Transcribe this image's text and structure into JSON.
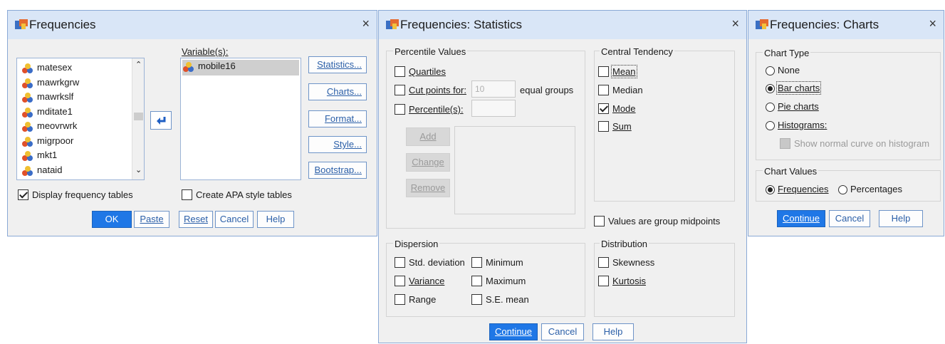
{
  "frequencies": {
    "title": "Frequencies",
    "close": "×",
    "variables_label": "Variable(s):",
    "source_items": [
      "matesex",
      "mawrkgrw",
      "mawrkslf",
      "mditate1",
      "meovrwrk",
      "migrpoor",
      "mkt1",
      "nataid"
    ],
    "target_items": [
      "mobile16"
    ],
    "side_buttons": [
      "Statistics...",
      "Charts...",
      "Format...",
      "Style...",
      "Bootstrap..."
    ],
    "display_freq": "Display frequency tables",
    "create_apa": "Create APA style tables",
    "buttons": {
      "ok": "OK",
      "paste": "Paste",
      "reset": "Reset",
      "cancel": "Cancel",
      "help": "Help"
    }
  },
  "statistics": {
    "title": "Frequencies: Statistics",
    "close": "×",
    "percentile_group": "Percentile Values",
    "quartiles": "Quartiles",
    "cut_points": "Cut points for:",
    "cut_value": "10",
    "equal_groups": "equal groups",
    "percentiles": "Percentile(s):",
    "add": "Add",
    "change": "Change",
    "remove": "Remove",
    "central_group": "Central Tendency",
    "mean": "Mean",
    "median": "Median",
    "mode": "Mode",
    "sum": "Sum",
    "group_midpoints": "Values are group midpoints",
    "dispersion_group": "Dispersion",
    "std_dev": "Std. deviation",
    "minimum": "Minimum",
    "variance": "Variance",
    "maximum": "Maximum",
    "range": "Range",
    "se_mean": "S.E. mean",
    "distribution_group": "Distribution",
    "skewness": "Skewness",
    "kurtosis": "Kurtosis",
    "buttons": {
      "continue": "Continue",
      "cancel": "Cancel",
      "help": "Help"
    }
  },
  "charts": {
    "title": "Frequencies: Charts",
    "close": "×",
    "chart_type_group": "Chart Type",
    "none": "None",
    "bar": "Bar charts",
    "pie": "Pie charts",
    "histograms": "Histograms:",
    "show_normal": "Show normal curve on histogram",
    "chart_values_group": "Chart Values",
    "frequencies": "Frequencies",
    "percentages": "Percentages",
    "buttons": {
      "continue": "Continue",
      "cancel": "Cancel",
      "help": "Help"
    }
  },
  "colors": {
    "accent": "#1f77e6",
    "titlebar": "#d9e6f7",
    "dialog_bg": "#f0f0f0"
  }
}
